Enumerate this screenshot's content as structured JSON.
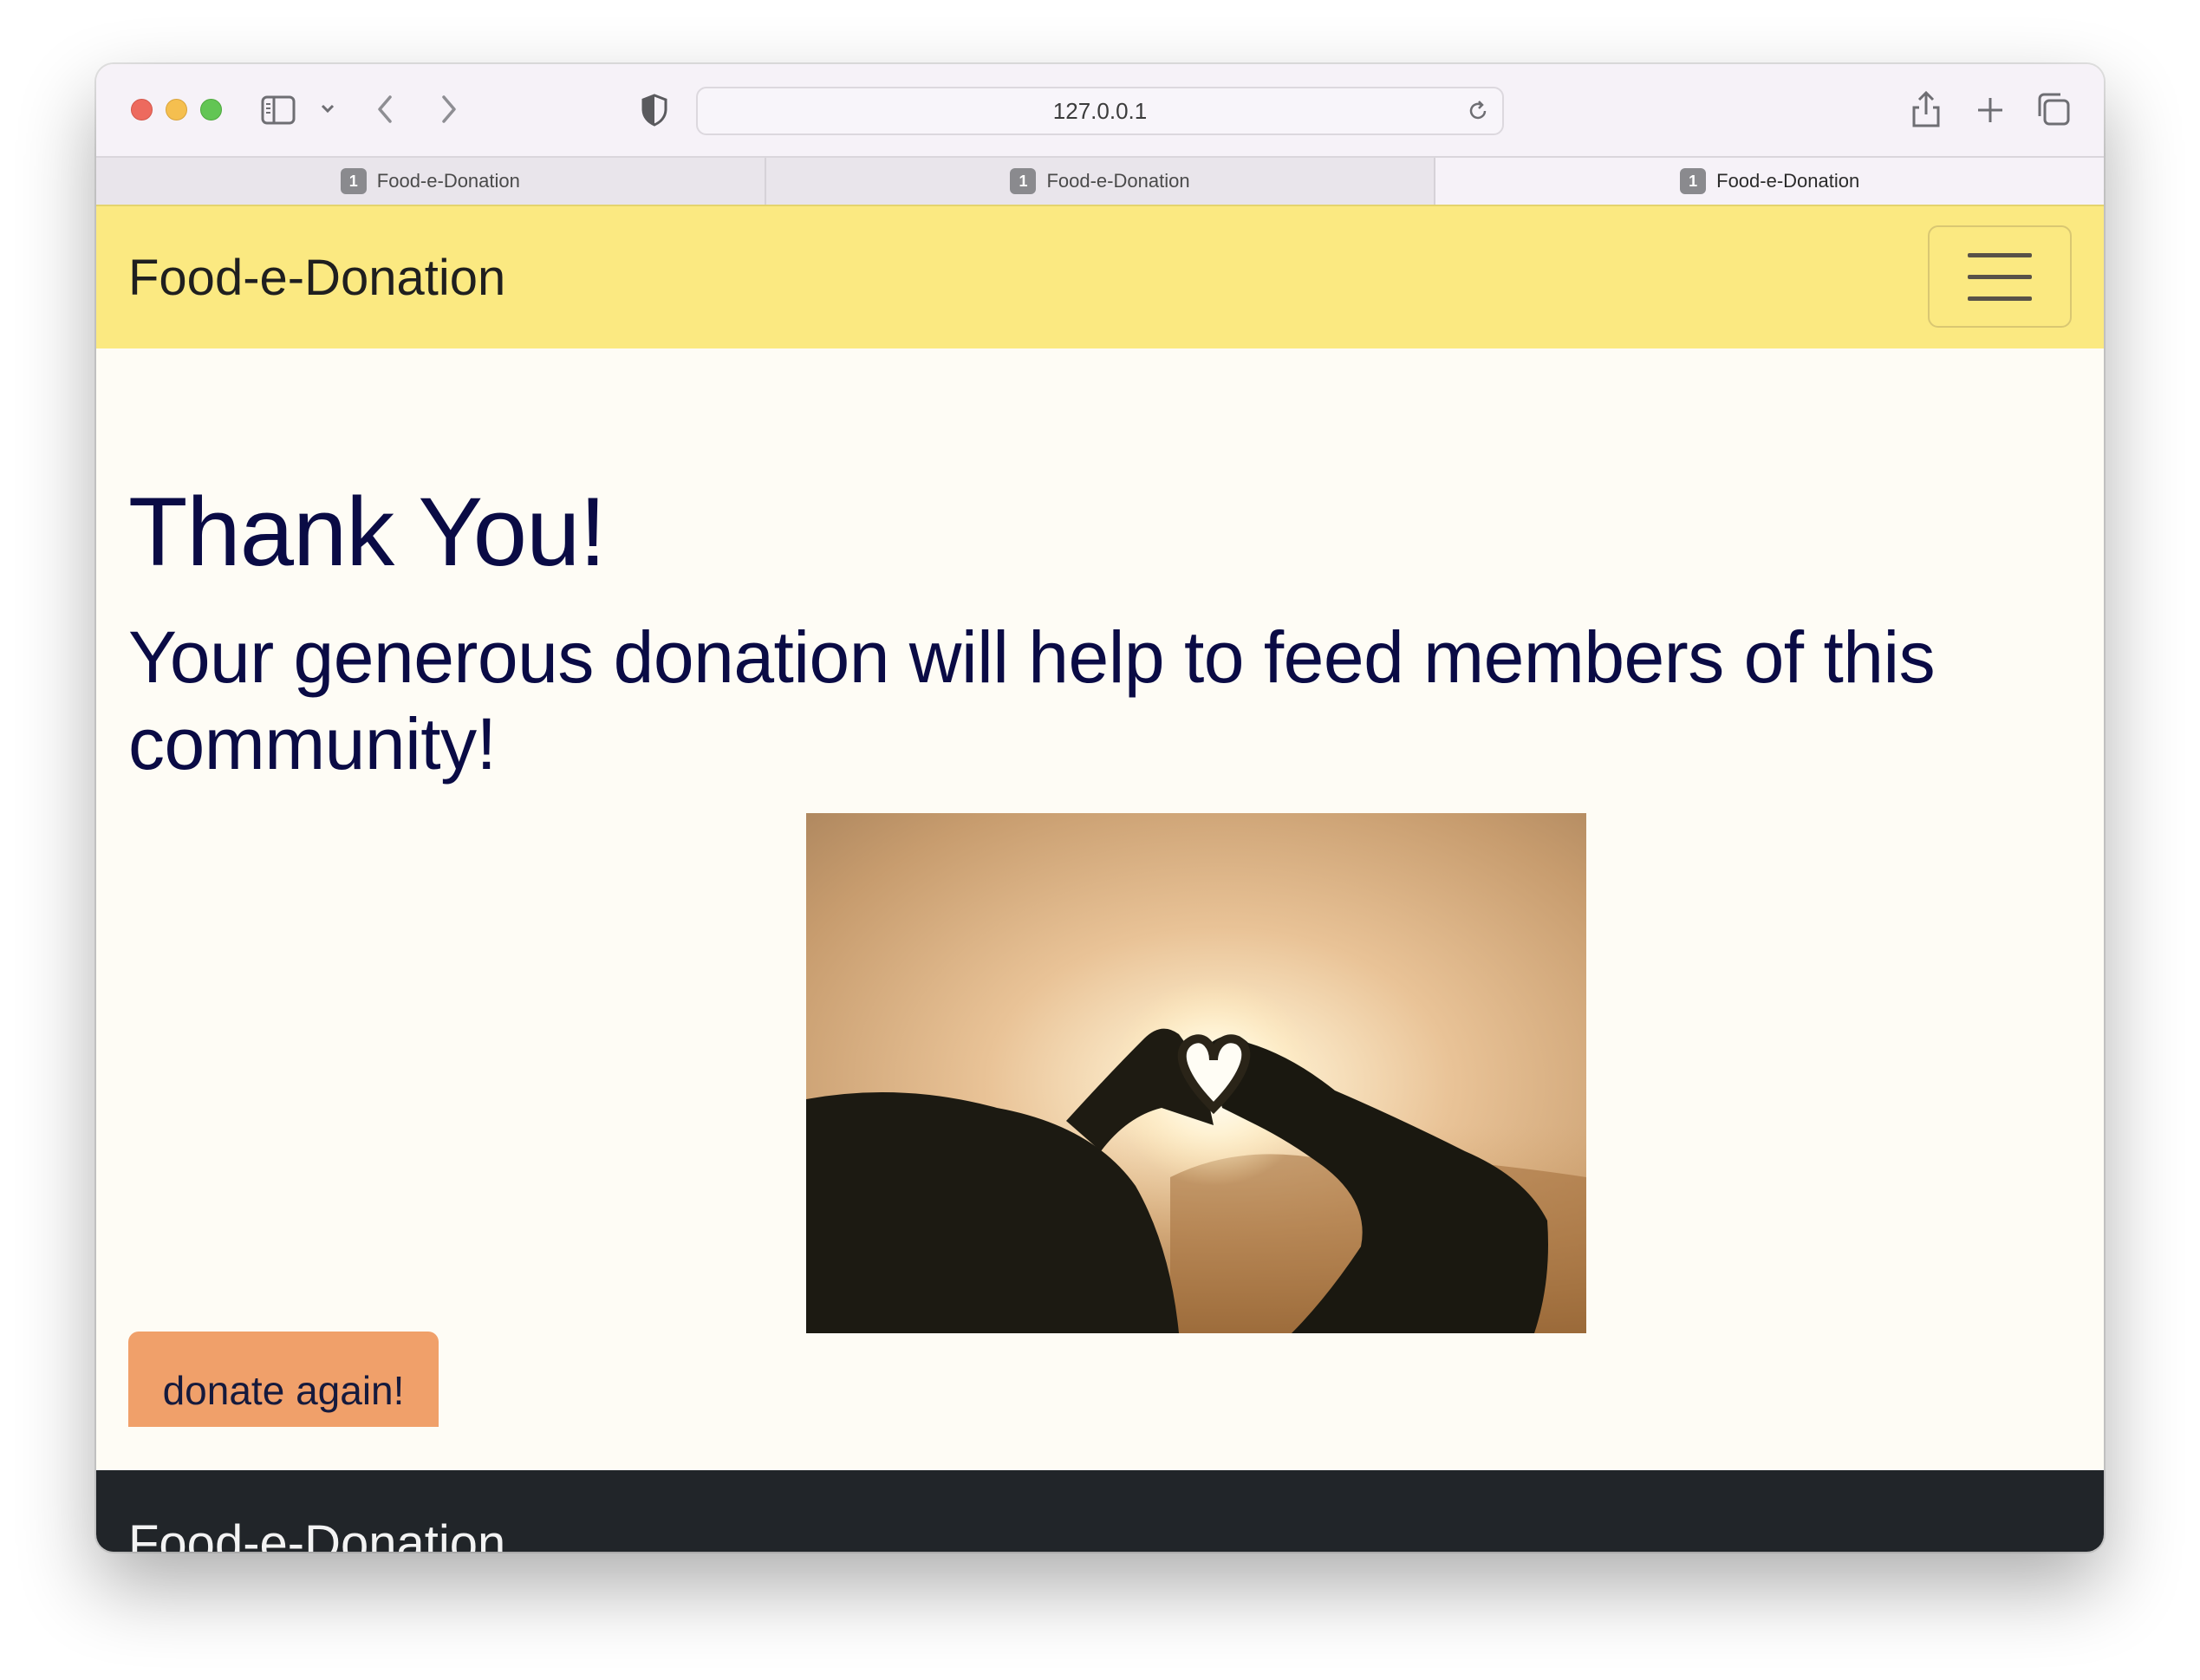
{
  "browser": {
    "url": "127.0.0.1",
    "tabs": [
      {
        "badge": "1",
        "title": "Food-e-Donation"
      },
      {
        "badge": "1",
        "title": "Food-e-Donation"
      },
      {
        "badge": "1",
        "title": "Food-e-Donation"
      }
    ],
    "active_tab": 2
  },
  "navbar": {
    "brand": "Food-e-Donation",
    "toggler_icon": "hamburger-menu-icon"
  },
  "main": {
    "heading": "Thank You!",
    "subheading": "Your generous donation will help to feed members of this community!",
    "photo": "sunset-heart-hands-photo",
    "donate_button": "donate again!"
  },
  "footer": {
    "brand": "Food-e-Donation"
  },
  "colors": {
    "navbar_bg": "#fbe981",
    "heading_text": "#0a0b45",
    "button_bg": "#f0a06a",
    "footer_bg": "#212529",
    "page_bg": "#fefcf5"
  }
}
